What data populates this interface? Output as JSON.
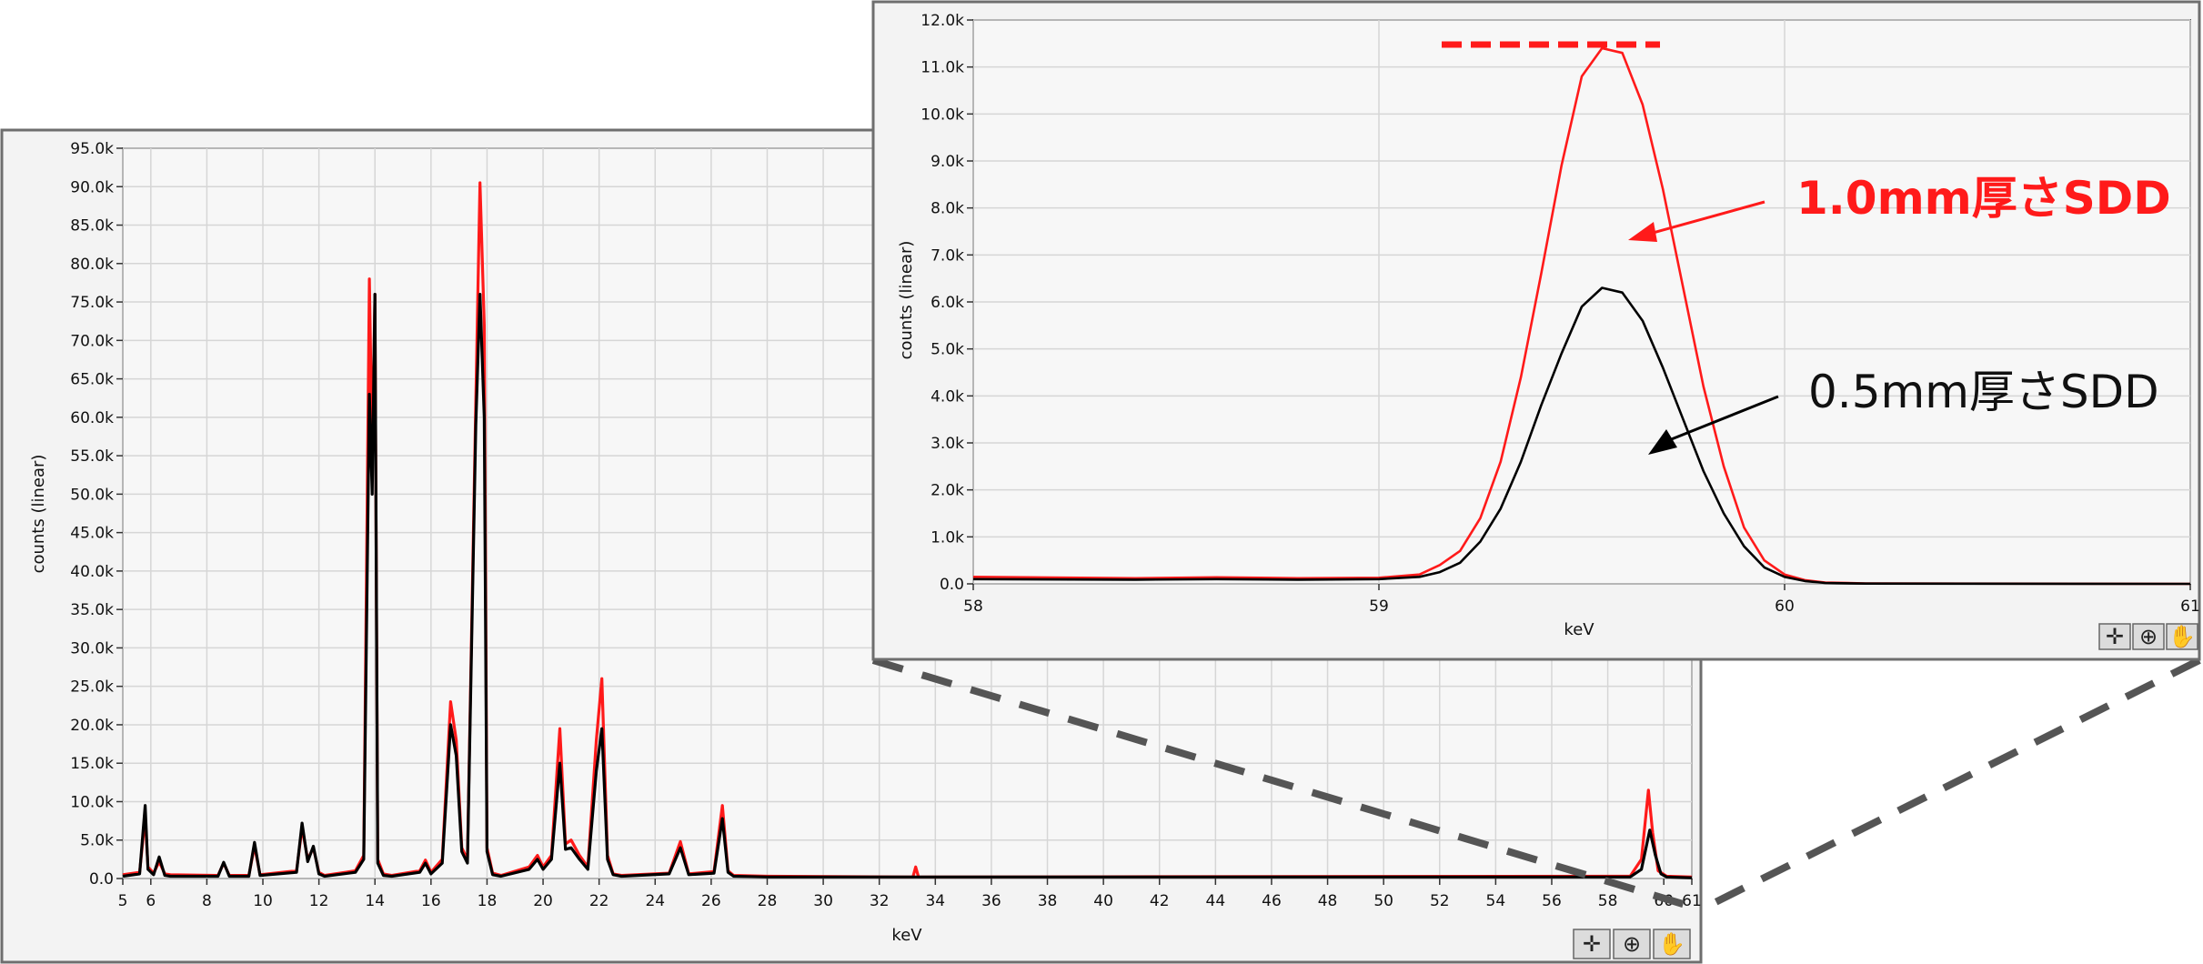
{
  "chart_data": [
    {
      "type": "line",
      "title": "",
      "xlabel": "keV",
      "ylabel": "counts (linear)",
      "xlim": [
        5,
        61
      ],
      "ylim": [
        0,
        95000
      ],
      "x_ticks": [
        "5",
        "6",
        "8",
        "10",
        "12",
        "14",
        "16",
        "18",
        "20",
        "22",
        "24",
        "26",
        "28",
        "30",
        "32",
        "34",
        "36",
        "38",
        "40",
        "42",
        "44",
        "46",
        "48",
        "50",
        "52",
        "54",
        "56",
        "58",
        "60",
        "61"
      ],
      "y_ticks": [
        "0.0",
        "5.0k",
        "10.0k",
        "15.0k",
        "20.0k",
        "25.0k",
        "30.0k",
        "35.0k",
        "40.0k",
        "45.0k",
        "50.0k",
        "55.0k",
        "60.0k",
        "65.0k",
        "70.0k",
        "75.0k",
        "80.0k",
        "85.0k",
        "90.0k",
        "95.0k"
      ],
      "grid": true,
      "series": [
        {
          "color": "#ff1a1a",
          "x": [
            5,
            5.6,
            5.8,
            5.9,
            6.1,
            6.3,
            6.5,
            6.7,
            8.4,
            8.6,
            8.8,
            9.5,
            9.7,
            9.9,
            11.2,
            11.4,
            11.6,
            11.8,
            12.0,
            12.2,
            13.3,
            13.6,
            13.8,
            13.9,
            14.0,
            14.1,
            14.3,
            14.6,
            15.6,
            15.8,
            16.0,
            16.4,
            16.7,
            16.9,
            17.1,
            17.3,
            17.6,
            17.75,
            17.9,
            18.0,
            18.2,
            18.5,
            19.5,
            19.8,
            20.0,
            20.3,
            20.6,
            20.8,
            21.0,
            21.3,
            21.6,
            21.9,
            22.1,
            22.3,
            22.5,
            22.8,
            24.5,
            24.9,
            25.2,
            26.1,
            26.4,
            26.6,
            26.8,
            28,
            33.2,
            33.3,
            33.4,
            58.8,
            59.2,
            59.45,
            59.6,
            59.8,
            60.1,
            61
          ],
          "y": [
            500,
            800,
            8000,
            1500,
            700,
            2200,
            600,
            500,
            400,
            2000,
            400,
            400,
            4200,
            500,
            1000,
            6600,
            2500,
            4000,
            800,
            400,
            1000,
            3000,
            78000,
            55000,
            76000,
            2500,
            600,
            400,
            1000,
            2400,
            800,
            2500,
            23000,
            18000,
            4000,
            2500,
            62000,
            90500,
            72000,
            4000,
            700,
            400,
            1500,
            3000,
            1500,
            3000,
            19500,
            4500,
            5000,
            3000,
            1500,
            18000,
            26000,
            3000,
            600,
            400,
            700,
            4800,
            600,
            900,
            9500,
            1000,
            400,
            300,
            200,
            1500,
            200,
            300,
            2500,
            11500,
            6000,
            1000,
            300,
            200
          ]
        },
        {
          "color": "#000000",
          "x": [
            5,
            5.6,
            5.8,
            5.9,
            6.1,
            6.3,
            6.5,
            6.7,
            8.4,
            8.6,
            8.8,
            9.5,
            9.7,
            9.9,
            11.2,
            11.4,
            11.6,
            11.8,
            12.0,
            12.2,
            13.3,
            13.6,
            13.8,
            13.9,
            14.0,
            14.1,
            14.3,
            14.6,
            15.6,
            15.8,
            16.0,
            16.4,
            16.7,
            16.9,
            17.1,
            17.3,
            17.6,
            17.75,
            17.9,
            18.0,
            18.2,
            18.5,
            19.5,
            19.8,
            20.0,
            20.3,
            20.6,
            20.8,
            21.0,
            21.3,
            21.6,
            21.9,
            22.1,
            22.3,
            22.5,
            22.8,
            24.5,
            24.9,
            25.2,
            26.1,
            26.4,
            26.6,
            26.8,
            28,
            58.8,
            59.2,
            59.5,
            59.7,
            59.9,
            60.1,
            61
          ],
          "y": [
            300,
            600,
            9500,
            1200,
            500,
            2800,
            400,
            300,
            300,
            2100,
            300,
            300,
            4700,
            400,
            800,
            7200,
            2200,
            4200,
            600,
            300,
            800,
            2500,
            63000,
            50000,
            76000,
            2000,
            400,
            300,
            800,
            2000,
            600,
            2000,
            20000,
            16000,
            3500,
            2000,
            59000,
            76000,
            60000,
            3500,
            500,
            300,
            1200,
            2500,
            1200,
            2500,
            15000,
            3800,
            4000,
            2500,
            1200,
            14000,
            19500,
            2500,
            500,
            300,
            600,
            4000,
            500,
            700,
            7800,
            800,
            300,
            200,
            200,
            1200,
            6300,
            3000,
            600,
            200,
            100
          ]
        }
      ]
    },
    {
      "type": "line",
      "title": "",
      "xlabel": "keV",
      "ylabel": "counts (linear)",
      "xlim": [
        58,
        61
      ],
      "ylim": [
        0,
        12000
      ],
      "x_ticks": [
        "58",
        "59",
        "60",
        "61"
      ],
      "y_ticks": [
        "0.0",
        "1.0k",
        "2.0k",
        "3.0k",
        "4.0k",
        "5.0k",
        "6.0k",
        "7.0k",
        "8.0k",
        "9.0k",
        "10.0k",
        "11.0k",
        "12.0k"
      ],
      "grid": true,
      "annotations": [
        "1.0mm厚さSDD",
        "0.5mm厚さSDD"
      ],
      "series": [
        {
          "color": "#ff1a1a",
          "x": [
            58,
            58.4,
            58.6,
            58.8,
            59.0,
            59.1,
            59.15,
            59.2,
            59.25,
            59.3,
            59.35,
            59.4,
            59.45,
            59.5,
            59.55,
            59.6,
            59.65,
            59.7,
            59.75,
            59.8,
            59.85,
            59.9,
            59.95,
            60.0,
            60.05,
            60.1,
            60.2,
            61
          ],
          "y": [
            150,
            120,
            140,
            120,
            130,
            200,
            400,
            700,
            1400,
            2600,
            4400,
            6600,
            8900,
            10800,
            11400,
            11300,
            10200,
            8400,
            6300,
            4200,
            2500,
            1200,
            500,
            200,
            80,
            30,
            10,
            0
          ],
          "peak_marker": 11400
        },
        {
          "color": "#000000",
          "x": [
            58,
            58.4,
            58.6,
            58.8,
            59.0,
            59.1,
            59.15,
            59.2,
            59.25,
            59.3,
            59.35,
            59.4,
            59.45,
            59.5,
            59.55,
            59.6,
            59.65,
            59.7,
            59.75,
            59.8,
            59.85,
            59.9,
            59.95,
            60.0,
            60.05,
            60.1,
            60.2,
            61
          ],
          "y": [
            100,
            90,
            100,
            90,
            100,
            150,
            250,
            450,
            900,
            1600,
            2600,
            3800,
            4900,
            5900,
            6300,
            6200,
            5600,
            4600,
            3500,
            2400,
            1500,
            800,
            350,
            150,
            60,
            20,
            5,
            0
          ]
        }
      ]
    }
  ]
}
